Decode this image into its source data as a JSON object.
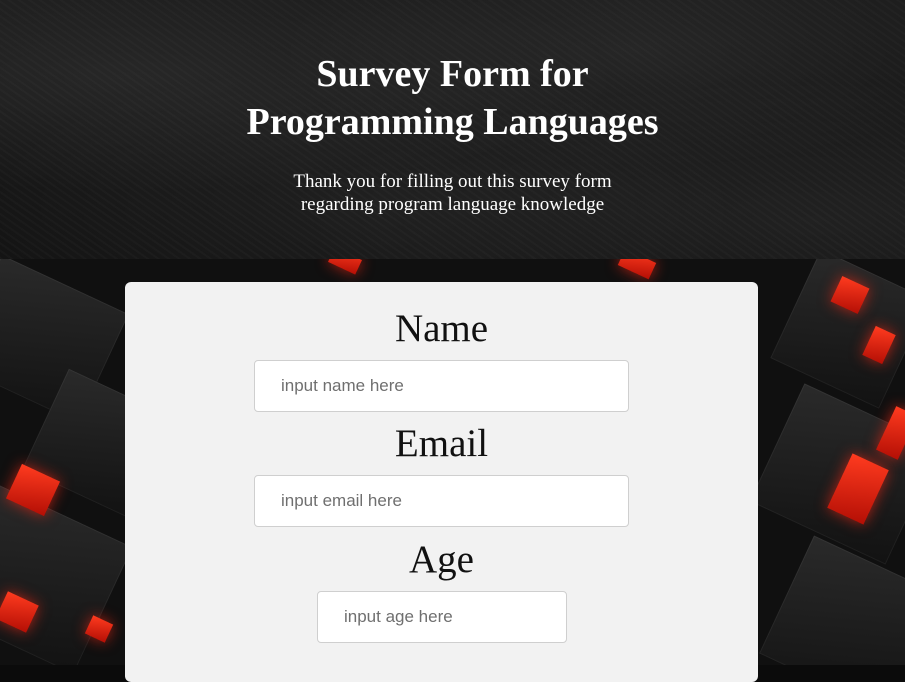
{
  "header": {
    "title_line1": "Survey Form for",
    "title_line2": "Programming Languages",
    "subtitle_line1": "Thank you for filling out this survey form",
    "subtitle_line2": "regarding program language knowledge"
  },
  "form": {
    "name": {
      "label": "Name",
      "placeholder": "input name here",
      "value": ""
    },
    "email": {
      "label": "Email",
      "placeholder": "input email here",
      "value": ""
    },
    "age": {
      "label": "Age",
      "placeholder": "input age here",
      "value": ""
    }
  },
  "colors": {
    "header_bg": "#1a1a1a",
    "card_bg": "#f2f2f2",
    "accent_red": "#ff3b1f"
  }
}
